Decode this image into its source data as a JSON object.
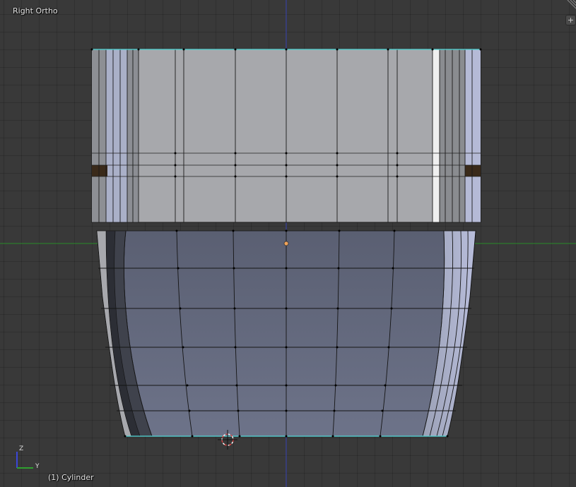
{
  "viewport": {
    "view_name": "Right Ortho",
    "object_label": "(1) Cylinder"
  },
  "axes": {
    "z_label": "Z",
    "y_label": "Y"
  },
  "icons": [
    "plus-icon",
    "region-corner-icon",
    "origin-dot-icon",
    "cursor-3d-icon",
    "axis-gizmo-icon"
  ],
  "colors": {
    "background": "#393939",
    "y_axis_line": "#2d8f2d",
    "z_axis_line": "#3b47b8",
    "selected_edge": "#4fd7d7",
    "origin_dot": "#f0a35a",
    "lower_face": "#5e6478",
    "upper_face": "#a8a9ad"
  }
}
